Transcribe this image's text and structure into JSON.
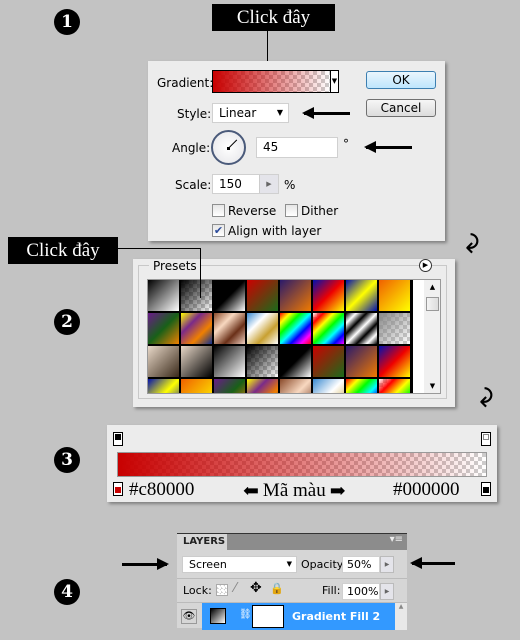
{
  "steps": [
    "1",
    "2",
    "3",
    "4"
  ],
  "callouts": {
    "first": "Click đây",
    "second": "Click đây"
  },
  "gradient_dialog": {
    "gradient_label": "Gradient:",
    "ok_label": "OK",
    "cancel_label": "Cancel",
    "style_label": "Style:",
    "style_value": "Linear",
    "angle_label": "Angle:",
    "angle_value": "45",
    "degree_symbol": "°",
    "scale_label": "Scale:",
    "scale_value": "150",
    "percent_symbol": "%",
    "reverse_label": "Reverse",
    "reverse_checked": false,
    "dither_label": "Dither",
    "dither_checked": false,
    "align_label": "Align with layer",
    "align_checked": true,
    "gradient_colors": [
      "#c80000",
      "transparent"
    ]
  },
  "presets_panel": {
    "title": "Presets",
    "swatches": [
      [
        "#000",
        "#fff"
      ],
      [
        "#000",
        "transparent"
      ],
      [
        "#000",
        "#000",
        "#fff"
      ],
      [
        "#c00",
        "#1a6b1a"
      ],
      [
        "#2a1a6b",
        "#f07a00"
      ],
      [
        "#0010b0",
        "#e00",
        "#ff0"
      ],
      [
        "#0010b0",
        "#ff0",
        "#0010b0"
      ],
      [
        "#f06000",
        "#ff0"
      ],
      [
        "#6a1a8a",
        "#186018",
        "#f08000"
      ],
      [
        "#ff0",
        "#7a2a8a",
        "#f08000",
        "#103090"
      ],
      [
        "#8a4a2a",
        "#f8d8c0",
        "#6a3018",
        "#f0d0c0"
      ],
      [
        "#3a8ad0",
        "#fff",
        "#c8a030",
        "#fff"
      ],
      [
        "#f00",
        "#ff0",
        "#0f0",
        "#0ff",
        "#00f",
        "#f0f",
        "#f00"
      ],
      [
        "transparent",
        "#f00",
        "#ff0",
        "#0f0",
        "#0ff",
        "#00f",
        "#f0f"
      ],
      [
        "#000",
        "#fff",
        "#000",
        "#fff",
        "#000",
        "#fff",
        "#000"
      ],
      [
        "#888",
        "transparent"
      ],
      [
        "#e8d8c8",
        "#3a2a1a"
      ],
      [
        "#e8d8c8",
        "#000"
      ],
      [
        "#000",
        "#fff"
      ],
      [
        "#000",
        "transparent"
      ],
      [
        "#000",
        "#000",
        "#fff"
      ],
      [
        "#c00",
        "#1a6b1a"
      ],
      [
        "#2a1a6b",
        "#f07a00"
      ],
      [
        "#0010b0",
        "#e00",
        "#ff0"
      ],
      [
        "#0010b0",
        "#ff0",
        "#0010b0"
      ],
      [
        "#f06000",
        "#ff0"
      ],
      [
        "#6a1a8a",
        "#186018",
        "#f08000"
      ],
      [
        "#ff0",
        "#7a2a8a",
        "#f08000",
        "#103090"
      ],
      [
        "#8a4a2a",
        "#f8d8c0",
        "#6a3018"
      ],
      [
        "#3a8ad0",
        "#fff",
        "#c8a030"
      ],
      [
        "#f00",
        "#ff0",
        "#0f0",
        "#0ff",
        "#00f",
        "#f0f"
      ],
      [
        "transparent",
        "#f00",
        "#ff0",
        "#0f0",
        "#00f"
      ]
    ]
  },
  "gradient_editor": {
    "left_color": "#c80000",
    "right_color": "#000000",
    "left_label": "#c80000",
    "right_label": "#000000",
    "middle_label": "Mã màu",
    "left_arrow": "⬅",
    "right_arrow": "➡"
  },
  "layers_panel": {
    "tab_label": "LAYERS",
    "blend_mode": "Screen",
    "opacity_label": "Opacity:",
    "opacity_value": "50%",
    "lock_label": "Lock:",
    "fill_label": "Fill:",
    "fill_value": "100%",
    "layer_name": "Gradient Fill 2",
    "selected_color": "#3399ff"
  }
}
